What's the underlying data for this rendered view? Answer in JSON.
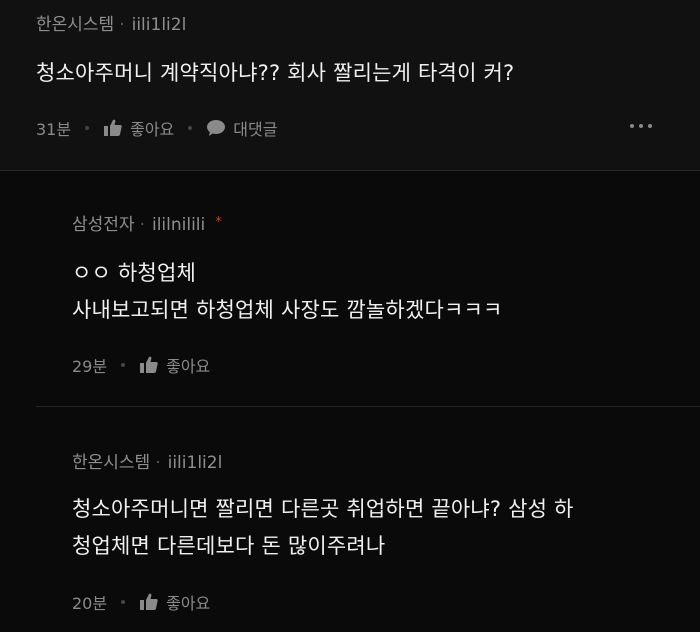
{
  "post": {
    "company": "한온시스템",
    "nickname": "iili1li2l",
    "text": "청소아주머니 계약직아냐?? 회사 짤리는게 타격이 커?",
    "time": "31분",
    "like_label": "좋아요",
    "reply_label": "대댓글"
  },
  "replies": [
    {
      "company": "삼성전자",
      "nickname": "ililnilili",
      "star": "*",
      "lines": [
        "ㅇㅇ 하청업체",
        "사내보고되면 하청업체 사장도 깜놀하겠다ㅋㅋㅋ"
      ],
      "time": "29분",
      "like_label": "좋아요"
    },
    {
      "company": "한온시스템",
      "nickname": "iili1li2l",
      "lines": [
        "청소아주머니면 짤리면 다른곳 취업하면 끝아냐? 삼성 하",
        "청업체면 다른데보다 돈 많이주려나"
      ],
      "time": "20분",
      "like_label": "좋아요"
    }
  ],
  "colors": {
    "background": "#0b0b0b",
    "post_bg": "#111111",
    "badge_star": "#e0342f"
  },
  "icons": {
    "like": "thumbs-up-icon",
    "reply": "speech-bubble-icon",
    "more": "more-dots-icon"
  }
}
